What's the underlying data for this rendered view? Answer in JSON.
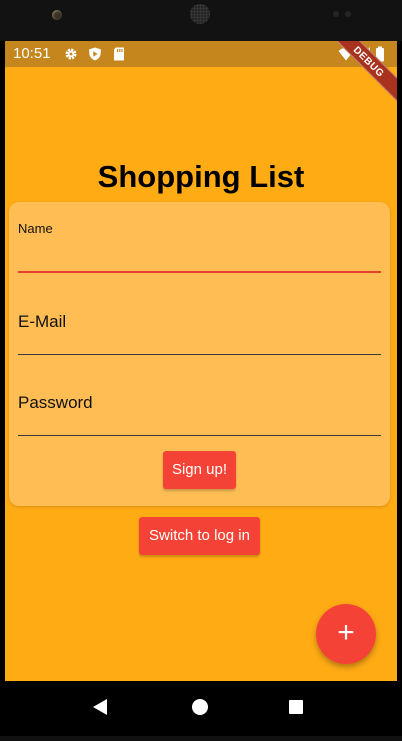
{
  "status_bar": {
    "time": "10:51",
    "icons": [
      "gear-icon",
      "shield-play-icon",
      "sd-card-icon",
      "wifi-icon",
      "signal-icon",
      "battery-icon"
    ]
  },
  "debug_banner": "DEBUG",
  "title": "Shopping List",
  "form": {
    "name_label": "Name",
    "name_value": "",
    "email_label": "E-Mail",
    "password_label": "Password",
    "submit_label": "Sign up!"
  },
  "switch_label": "Switch to log in",
  "fab_icon": "+",
  "colors": {
    "background": "#ffab14",
    "card": "#ffbd54",
    "accent": "#f44336",
    "status_bar": "#c4861d"
  },
  "nav": [
    "back-icon",
    "home-icon",
    "recents-icon"
  ]
}
